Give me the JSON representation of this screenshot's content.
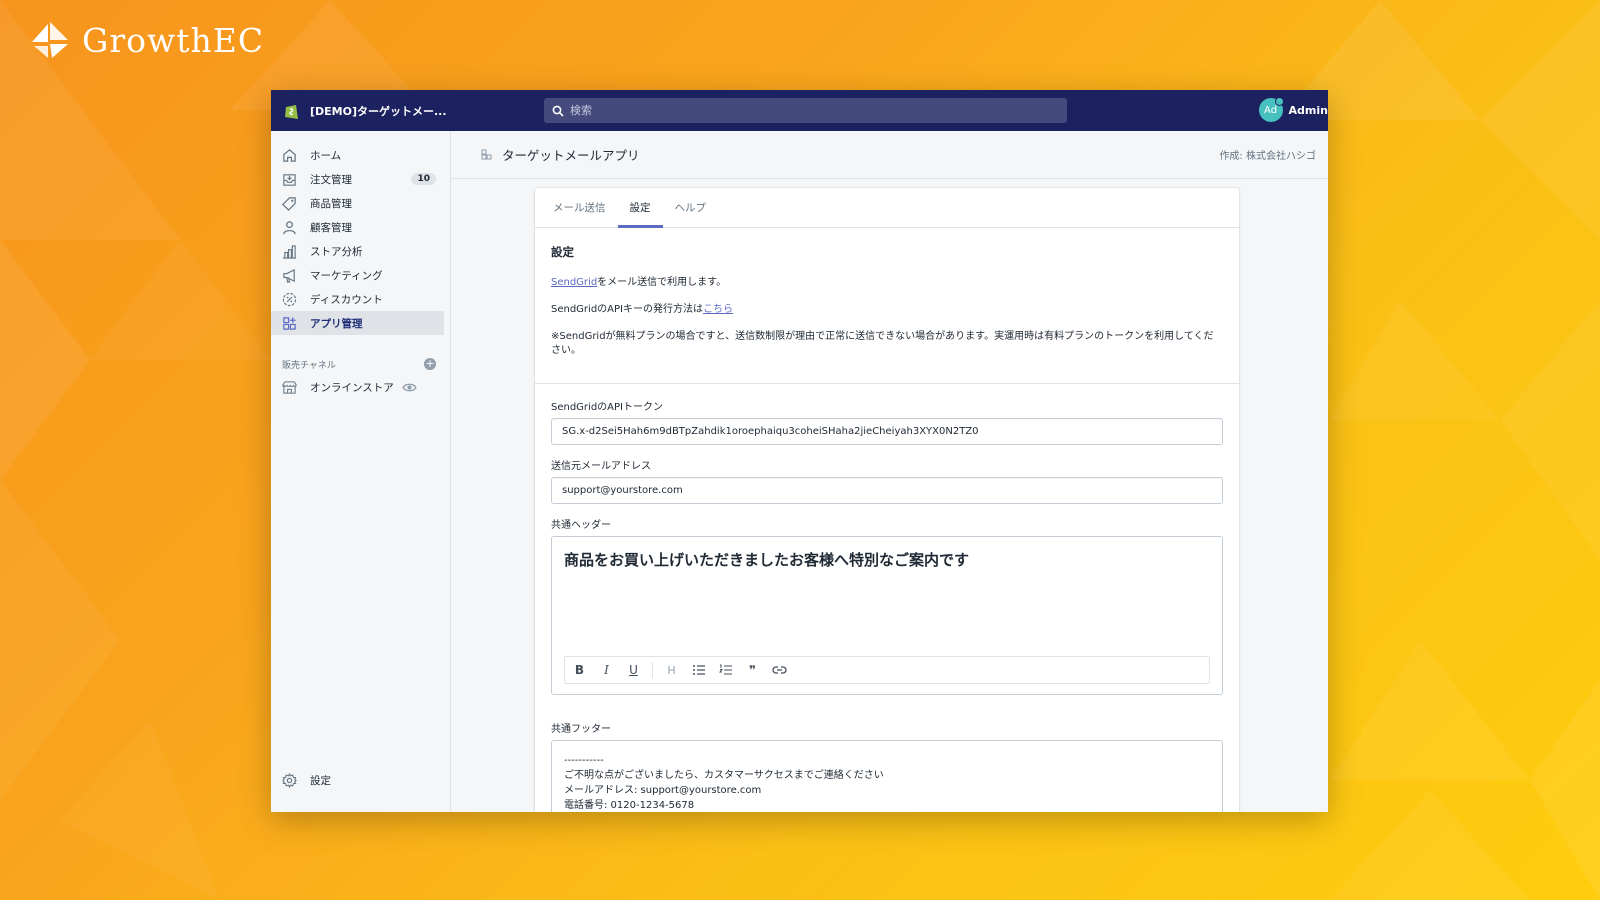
{
  "brand": {
    "name": "GrowthEC"
  },
  "topbar": {
    "store_name": "[DEMO]ターゲットメー...",
    "search_placeholder": "検索",
    "user_initials": "Ad",
    "user_name": "Admin"
  },
  "sidebar": {
    "items": [
      {
        "label": "ホーム",
        "icon": "home-icon"
      },
      {
        "label": "注文管理",
        "icon": "orders-icon",
        "badge": "10"
      },
      {
        "label": "商品管理",
        "icon": "tag-icon"
      },
      {
        "label": "顧客管理",
        "icon": "customer-icon"
      },
      {
        "label": "ストア分析",
        "icon": "analytics-icon"
      },
      {
        "label": "マーケティング",
        "icon": "megaphone-icon"
      },
      {
        "label": "ディスカウント",
        "icon": "discount-icon"
      },
      {
        "label": "アプリ管理",
        "icon": "apps-icon",
        "active": true
      }
    ],
    "channels_heading": "販売チャネル",
    "online_store": "オンラインストア",
    "settings": "設定"
  },
  "app": {
    "title": "ターゲットメールアプリ",
    "author": "作成: 株式会社ハシゴ"
  },
  "tabs": [
    "メール送信",
    "設定",
    "ヘルプ"
  ],
  "settings": {
    "title": "設定",
    "line1_link": "SendGrid",
    "line1_rest": "をメール送信で利用します。",
    "line2_text": "SendGridのAPIキーの発行方法は",
    "line2_link": "こちら",
    "note": "※SendGridが無料プランの場合ですと、送信数制限が理由で正常に送信できない場合があります。実運用時は有料プランのトークンを利用してください。"
  },
  "form": {
    "token_label": "SendGridのAPIトークン",
    "token_value": "SG.x-d2Sei5Hah6m9dBTpZahdik1oroephaiqu3coheiSHaha2jieCheiyah3XYX0N2TZ0",
    "from_label": "送信元メールアドレス",
    "from_value": "support@yourstore.com",
    "header_label": "共通ヘッダー",
    "header_value": "商品をお買い上げいただきましたお客様へ特別なご案内です",
    "footer_label": "共通フッター",
    "footer_lines": [
      "-----------",
      "ご不明な点がございましたら、カスタマーサクセスまでご連絡ください",
      "",
      "メールアドレス: support@yourstore.com",
      "電話番号: 0120-1234-5678"
    ]
  },
  "toolbar": {
    "bold": "B",
    "italic": "I",
    "underline": "U",
    "heading": "H",
    "quote": "❞"
  },
  "colors": {
    "topbar": "#1c2260",
    "accent": "#5c6ac4",
    "background_orange": "#f9a51c",
    "background_yellow": "#ffcd0e"
  }
}
